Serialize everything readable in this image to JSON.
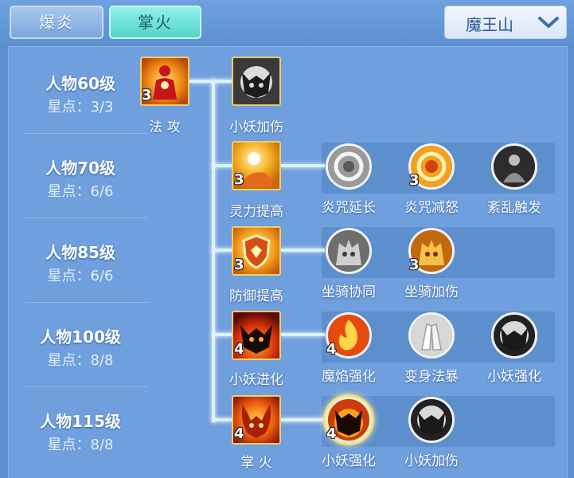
{
  "tabs": [
    {
      "label": "爆炎",
      "active": false
    },
    {
      "label": "掌火",
      "active": true
    }
  ],
  "zone_select": {
    "label": "魔王山",
    "icon": "chevron-down-icon"
  },
  "rows": [
    {
      "level": "人物60级",
      "stars": "星点：3/3"
    },
    {
      "level": "人物70级",
      "stars": "星点：6/6"
    },
    {
      "level": "人物85级",
      "stars": "星点：6/6"
    },
    {
      "level": "人物100级",
      "stars": "星点：8/8"
    },
    {
      "level": "人物115级",
      "stars": "星点：8/8"
    }
  ],
  "skills": {
    "fagong": {
      "name": "法 攻",
      "count": "3",
      "icon": "fire-body-icon"
    },
    "r1_main": {
      "name": "小妖加伤",
      "count": "",
      "icon": "demon-mask-icon"
    },
    "r2_main": {
      "name": "灵力提高",
      "count": "3",
      "icon": "glowing-hand-icon"
    },
    "r2_opts": [
      {
        "name": "炎咒延长",
        "count": "",
        "icon": "rune-circle-icon"
      },
      {
        "name": "炎咒减怒",
        "count": "3",
        "icon": "fire-rune-icon"
      },
      {
        "name": "紊乱触发",
        "count": "",
        "icon": "spirit-figure-icon"
      }
    ],
    "r3_main": {
      "name": "防御提高",
      "count": "3",
      "icon": "shield-icon"
    },
    "r3_opts": [
      {
        "name": "坐骑协同",
        "count": "",
        "icon": "beast-icon"
      },
      {
        "name": "坐骑加伤",
        "count": "3",
        "icon": "fire-beast-icon"
      }
    ],
    "r4_main": {
      "name": "小妖进化",
      "count": "4",
      "icon": "fire-demon-icon"
    },
    "r4_opts": [
      {
        "name": "魔焰强化",
        "count": "4",
        "icon": "flame-icon"
      },
      {
        "name": "变身法暴",
        "count": "",
        "icon": "palms-icon"
      },
      {
        "name": "小妖强化",
        "count": "",
        "icon": "demon-mask-icon"
      }
    ],
    "r5_main": {
      "name": "掌 火",
      "count": "4",
      "icon": "flame-demon-icon"
    },
    "r5_opts": [
      {
        "name": "小妖强化",
        "count": "4",
        "icon": "fire-demon-icon"
      },
      {
        "name": "小妖加伤",
        "count": "",
        "icon": "demon-mask-icon"
      }
    ]
  }
}
